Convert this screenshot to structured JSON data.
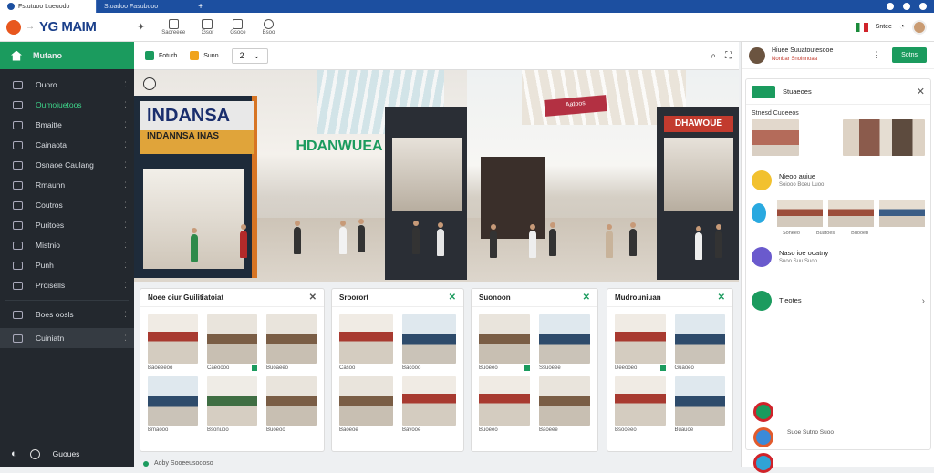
{
  "browser": {
    "tab_active": "Fstutuoo Lueuodo",
    "tab_inactive": "Stoadoo Fasubuoo",
    "new_tab": "+"
  },
  "header": {
    "logo_text": "YG MAIM",
    "tools": [
      {
        "label": "Saoreeee",
        "icon": "document-icon"
      },
      {
        "label": "Gsor",
        "icon": "copy-icon"
      },
      {
        "label": "Gsoce",
        "icon": "cart-icon"
      },
      {
        "label": "Bsoo",
        "icon": "gift-icon"
      }
    ],
    "user_label": "Sntee",
    "colors": {
      "primary": "#1b9b5e",
      "nav_bg": "#23282e",
      "tab_bar": "#1c4fa0"
    }
  },
  "sidebar": {
    "active_label": "Mutano",
    "items": [
      {
        "label": "Ouoro",
        "icon": "chart-icon"
      },
      {
        "label": "Oumoiuetoos",
        "icon": "grid-icon"
      },
      {
        "label": "Bmaitte",
        "icon": "list-icon"
      },
      {
        "label": "Cainaota",
        "icon": "puzzle-icon"
      },
      {
        "label": "Osnaoe Caulang",
        "icon": "chat-icon"
      },
      {
        "label": "Rmaunn",
        "icon": "building-icon"
      },
      {
        "label": "Coutros",
        "icon": "store-icon"
      },
      {
        "label": "Puritoes",
        "icon": "box-icon"
      },
      {
        "label": "Mistnio",
        "icon": "chart-pie-icon"
      },
      {
        "label": "Punh",
        "icon": "search-icon"
      },
      {
        "label": "Proisells",
        "icon": "tag-icon"
      },
      {
        "label": "Boes oosls",
        "icon": "user-icon"
      },
      {
        "label": "Cuiniatn",
        "icon": "settings-icon"
      }
    ],
    "footer_label": "Guoues"
  },
  "toolbar": {
    "btn1": "Foturb",
    "btn2": "Sunn",
    "page_value": "2"
  },
  "hero": {
    "left_sign": "INDANSA",
    "left_sign_sub": "INDANNSA INAS",
    "mid_sign": "HDANWUEA",
    "banner_text": "Aatoos",
    "right_sign": "DHAWOUE"
  },
  "cards": [
    {
      "title": "Noee oiur Guilitiatoiat",
      "items": [
        "Baoeeeoo",
        "Caeoooo",
        "Buoaeeo",
        "Bmaooo",
        "Bsonuoo",
        "Buoeoo"
      ]
    },
    {
      "title": "Sroorort",
      "items": [
        "Casoo",
        "Bacooo",
        "Baoeoe",
        "Bavooe"
      ]
    },
    {
      "title": "Suonoon",
      "items": [
        "Buoeeo",
        "Ssuoeee",
        "Buoeeo",
        "Baoeee"
      ]
    },
    {
      "title": "Mudrouniuan",
      "items": [
        "Deeooeo",
        "Guaoeo",
        "Bsooeeo",
        "Buauoe"
      ]
    }
  ],
  "footer_text": "Aoby Sooeeusoooso",
  "right_panel": {
    "user_name": "Hiuee Suuatoutesooe",
    "user_sub": "Nonbar Snoinnoaa",
    "action_btn": "Sotns",
    "panel_title": "Stuaeoes",
    "section_title": "Stnesd Cuoeeos",
    "row1_title": "Nieoo auiue",
    "row1_sub": "Soiooo Boeu Luoo",
    "mini_caps": [
      "Soneeo",
      "Buatoes",
      "Buooeb"
    ],
    "row3_title": "Naso ioe ooatny",
    "row3_sub": "Suoo Suu Suoo",
    "row4_title": "Tleotes",
    "stack_text": "Suoe Sutno Suoo"
  }
}
